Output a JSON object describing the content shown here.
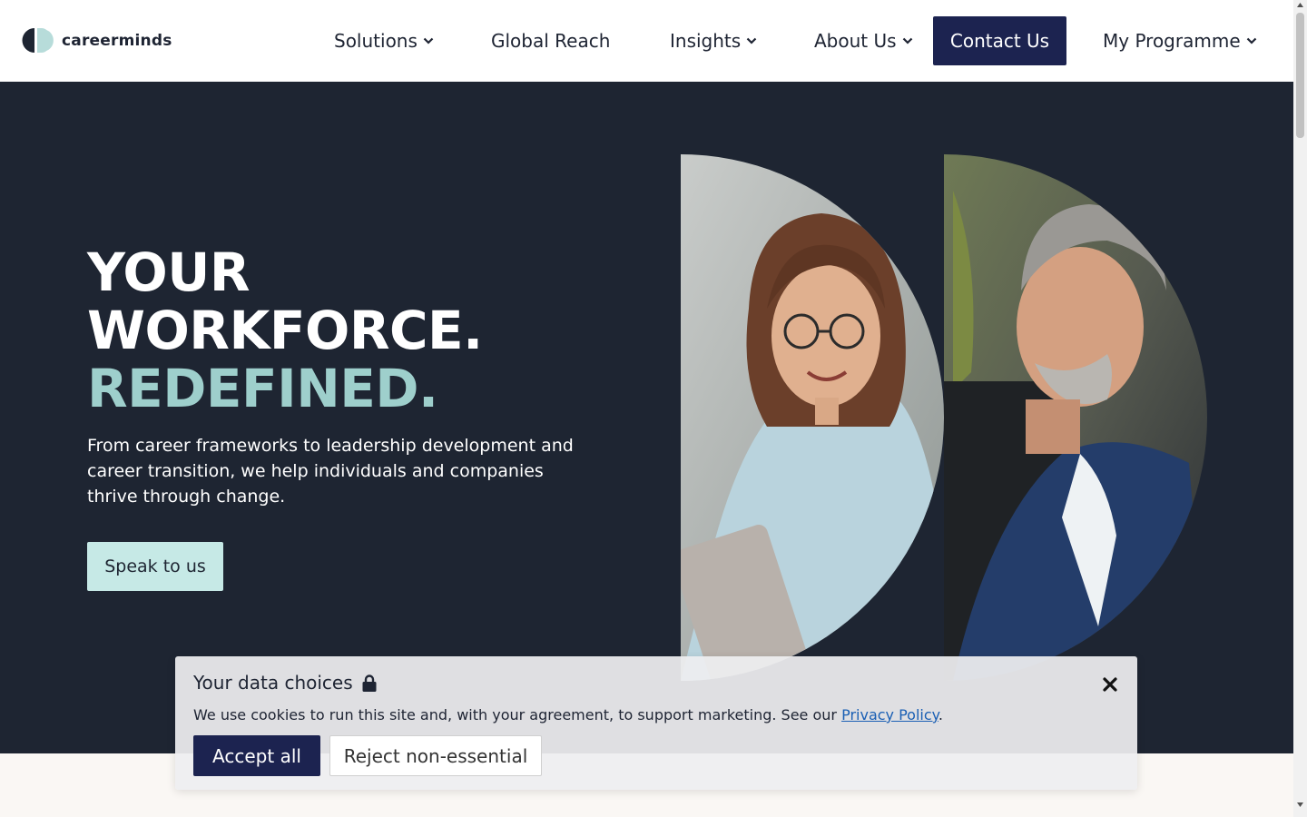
{
  "brand": {
    "name": "careerminds",
    "logo_icon": "careerminds-logo-icon"
  },
  "nav": {
    "items": [
      {
        "label": "Solutions",
        "has_dropdown": true
      },
      {
        "label": "Global Reach",
        "has_dropdown": false
      },
      {
        "label": "Insights",
        "has_dropdown": true
      },
      {
        "label": "About Us",
        "has_dropdown": true
      }
    ],
    "contact_label": "Contact Us",
    "my_programme_label": "My Programme"
  },
  "hero": {
    "title_line1": "YOUR",
    "title_line2": "WORKFORCE.",
    "title_line3": "REDEFINED.",
    "description": "From career frameworks to leadership development and career transition, we help individuals and companies thrive through change.",
    "cta_label": "Speak to us"
  },
  "cookie_banner": {
    "title": "Your data choices",
    "title_icon": "lock-icon",
    "text": "We use cookies to run this site and, with your agreement, to support marketing. See our ",
    "link_label": "Privacy Policy",
    "text_end": ".",
    "accept_label": "Accept all",
    "reject_label": "Reject non-essential"
  },
  "colors": {
    "navy": "#1c2350",
    "hero_bg": "#1e2532",
    "accent_teal": "#9ecfcc",
    "cta_bg": "#c6e9e6"
  }
}
